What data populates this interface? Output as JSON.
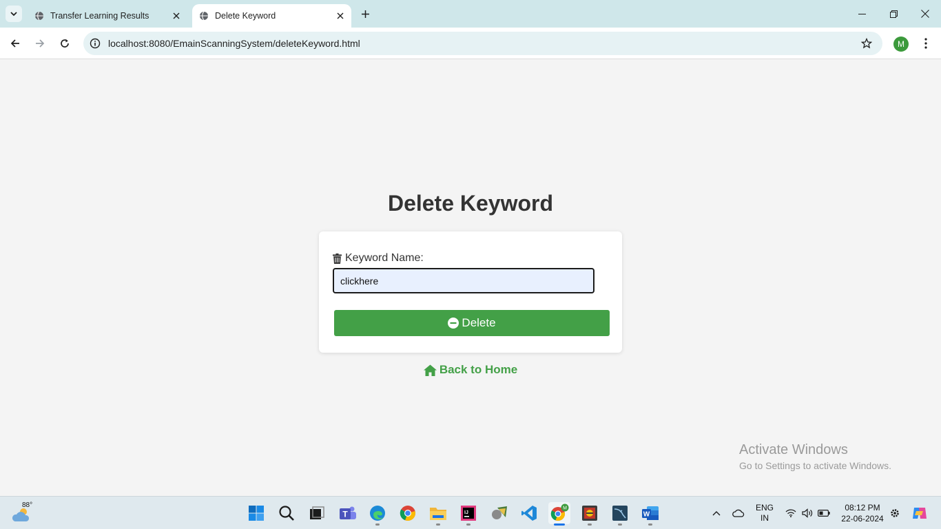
{
  "browser": {
    "tabs": [
      {
        "title": "Transfer Learning Results",
        "active": false
      },
      {
        "title": "Delete Keyword",
        "active": true
      }
    ],
    "url": "localhost:8080/EmainScanningSystem/deleteKeyword.html",
    "profile_initial": "M"
  },
  "page": {
    "title": "Delete Keyword",
    "form": {
      "label": "Keyword Name:",
      "input_value": "clickhere",
      "delete_label": "Delete"
    },
    "back_link": "Back to Home",
    "accent_color": "#43a047"
  },
  "watermark": {
    "line1": "Activate Windows",
    "line2": "Go to Settings to activate Windows."
  },
  "taskbar": {
    "weather_temp": "88°",
    "language": "ENG",
    "region": "IN",
    "time": "08:12 PM",
    "date": "22-06-2024",
    "apps": [
      "windows-start-icon",
      "search-icon",
      "task-view-icon",
      "teams-icon",
      "edge-icon",
      "chrome-icon",
      "file-explorer-icon",
      "intellij-icon",
      "app-icon",
      "vscode-icon",
      "chrome-profile-icon",
      "app-icon",
      "mysql-workbench-icon",
      "word-icon"
    ]
  }
}
